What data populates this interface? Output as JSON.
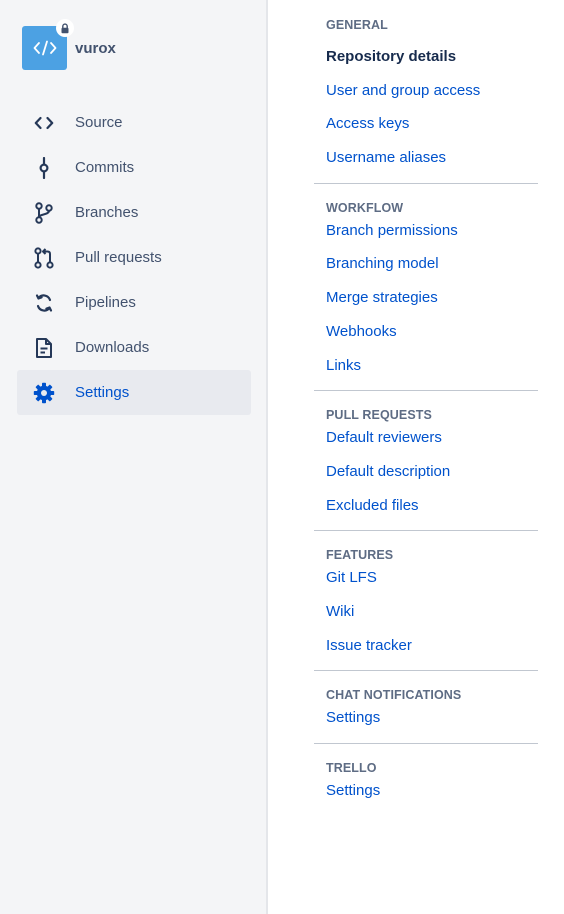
{
  "repo": {
    "name": "vurox",
    "avatar_icon": "code-icon",
    "private_icon": "lock-icon"
  },
  "nav": {
    "items": [
      {
        "label": "Source",
        "icon": "source-icon"
      },
      {
        "label": "Commits",
        "icon": "commits-icon"
      },
      {
        "label": "Branches",
        "icon": "branches-icon"
      },
      {
        "label": "Pull requests",
        "icon": "pull-request-icon"
      },
      {
        "label": "Pipelines",
        "icon": "pipelines-icon"
      },
      {
        "label": "Downloads",
        "icon": "downloads-icon"
      },
      {
        "label": "Settings",
        "icon": "settings-gear-icon",
        "active": true
      }
    ]
  },
  "settings": {
    "sections": [
      {
        "title": "GENERAL",
        "links": [
          "Repository details",
          "User and group access",
          "Access keys",
          "Username aliases"
        ]
      },
      {
        "title": "WORKFLOW",
        "links": [
          "Branch permissions",
          "Branching model",
          "Merge strategies",
          "Webhooks",
          "Links"
        ]
      },
      {
        "title": "PULL REQUESTS",
        "links": [
          "Default reviewers",
          "Default description",
          "Excluded files"
        ]
      },
      {
        "title": "FEATURES",
        "links": [
          "Git LFS",
          "Wiki",
          "Issue tracker"
        ]
      },
      {
        "title": "CHAT NOTIFICATIONS",
        "links": [
          "Settings"
        ]
      },
      {
        "title": "TRELLO",
        "links": [
          "Settings"
        ]
      }
    ]
  },
  "colors": {
    "sidebar_bg": "#f4f5f7",
    "accent": "#0052cc",
    "avatar_bg": "#4ca1e3",
    "text_muted": "#42526e"
  }
}
